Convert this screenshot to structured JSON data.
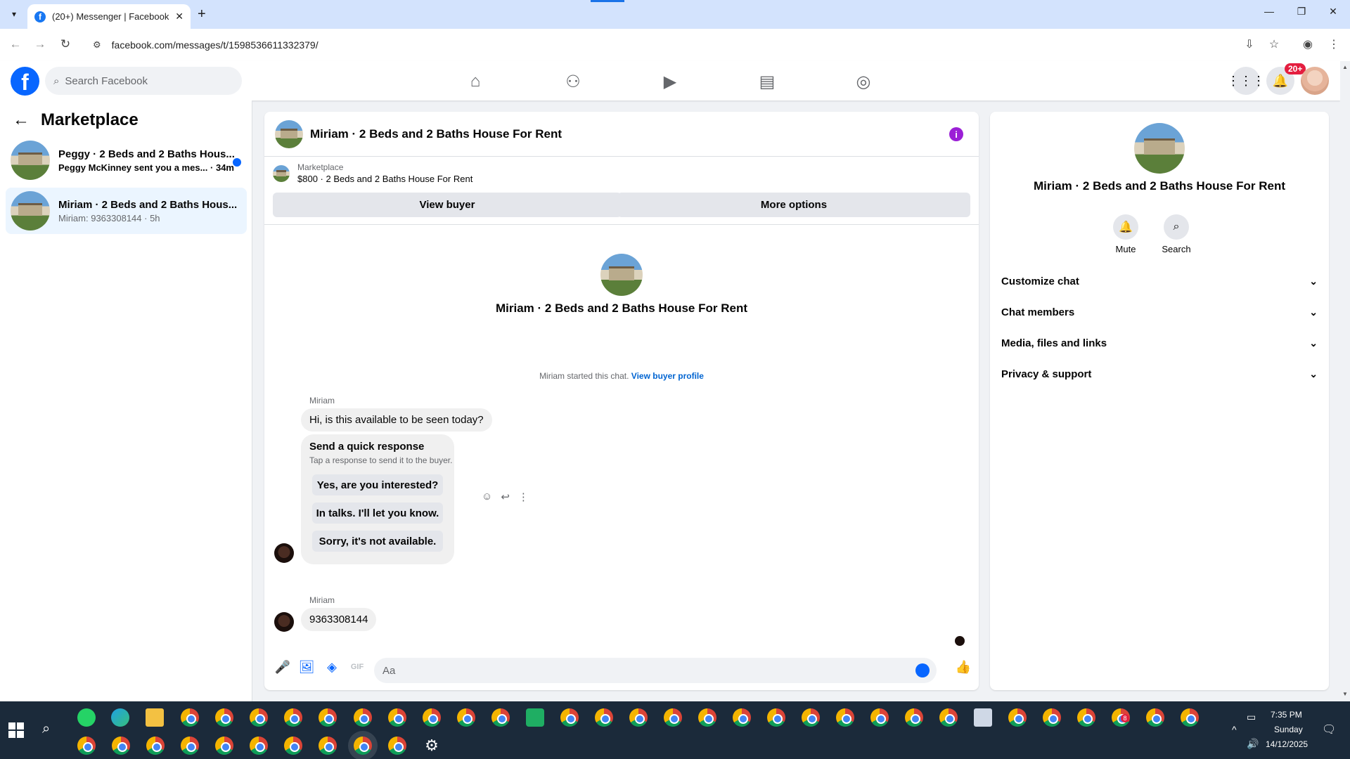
{
  "browser": {
    "tab_title": "(20+) Messenger | Facebook",
    "url": "facebook.com/messages/t/1598536611332379/"
  },
  "fb": {
    "search_placeholder": "Search Facebook",
    "notifications_badge": "20+"
  },
  "sidebar": {
    "title": "Marketplace",
    "conversations": [
      {
        "name": "Peggy · 2 Beds and 2 Baths Hous...",
        "preview": "Peggy McKinney sent you a mes...",
        "time": "34m",
        "unread": true
      },
      {
        "name": "Miriam · 2 Beds and 2 Baths Hous...",
        "preview": "Miriam: 9363308144 · 5h",
        "time": "",
        "unread": false
      }
    ]
  },
  "chat": {
    "title": "Miriam · 2 Beds and 2 Baths House For Rent",
    "listing_source": "Marketplace",
    "listing_text": "$800 · 2 Beds and 2 Baths House For Rent",
    "view_buyer_label": "View buyer",
    "more_options_label": "More options",
    "intro_name": "Miriam · 2 Beds and 2 Baths House For Rent",
    "started_text": "Miriam started this chat.",
    "view_buyer_profile": "View buyer profile",
    "messages": [
      {
        "sender": "Miriam",
        "text": "Hi, is this available to be seen today?"
      },
      {
        "sender": "Miriam",
        "text": "9363308144"
      }
    ],
    "quick_response": {
      "title": "Send a quick response",
      "subtitle": "Tap a response to send it to the buyer.",
      "options": [
        "Yes, are you interested?",
        "In talks. I'll let you know.",
        "Sorry, it's not available."
      ]
    },
    "composer_placeholder": "Aa"
  },
  "info_panel": {
    "name": "Miriam · 2 Beds and 2 Baths House For Rent",
    "mute_label": "Mute",
    "search_label": "Search",
    "sections": [
      "Customize chat",
      "Chat members",
      "Media, files and links",
      "Privacy & support"
    ]
  },
  "taskbar": {
    "time": "7:35 PM",
    "day": "Sunday",
    "date": "14/12/2025",
    "badge": "8"
  }
}
